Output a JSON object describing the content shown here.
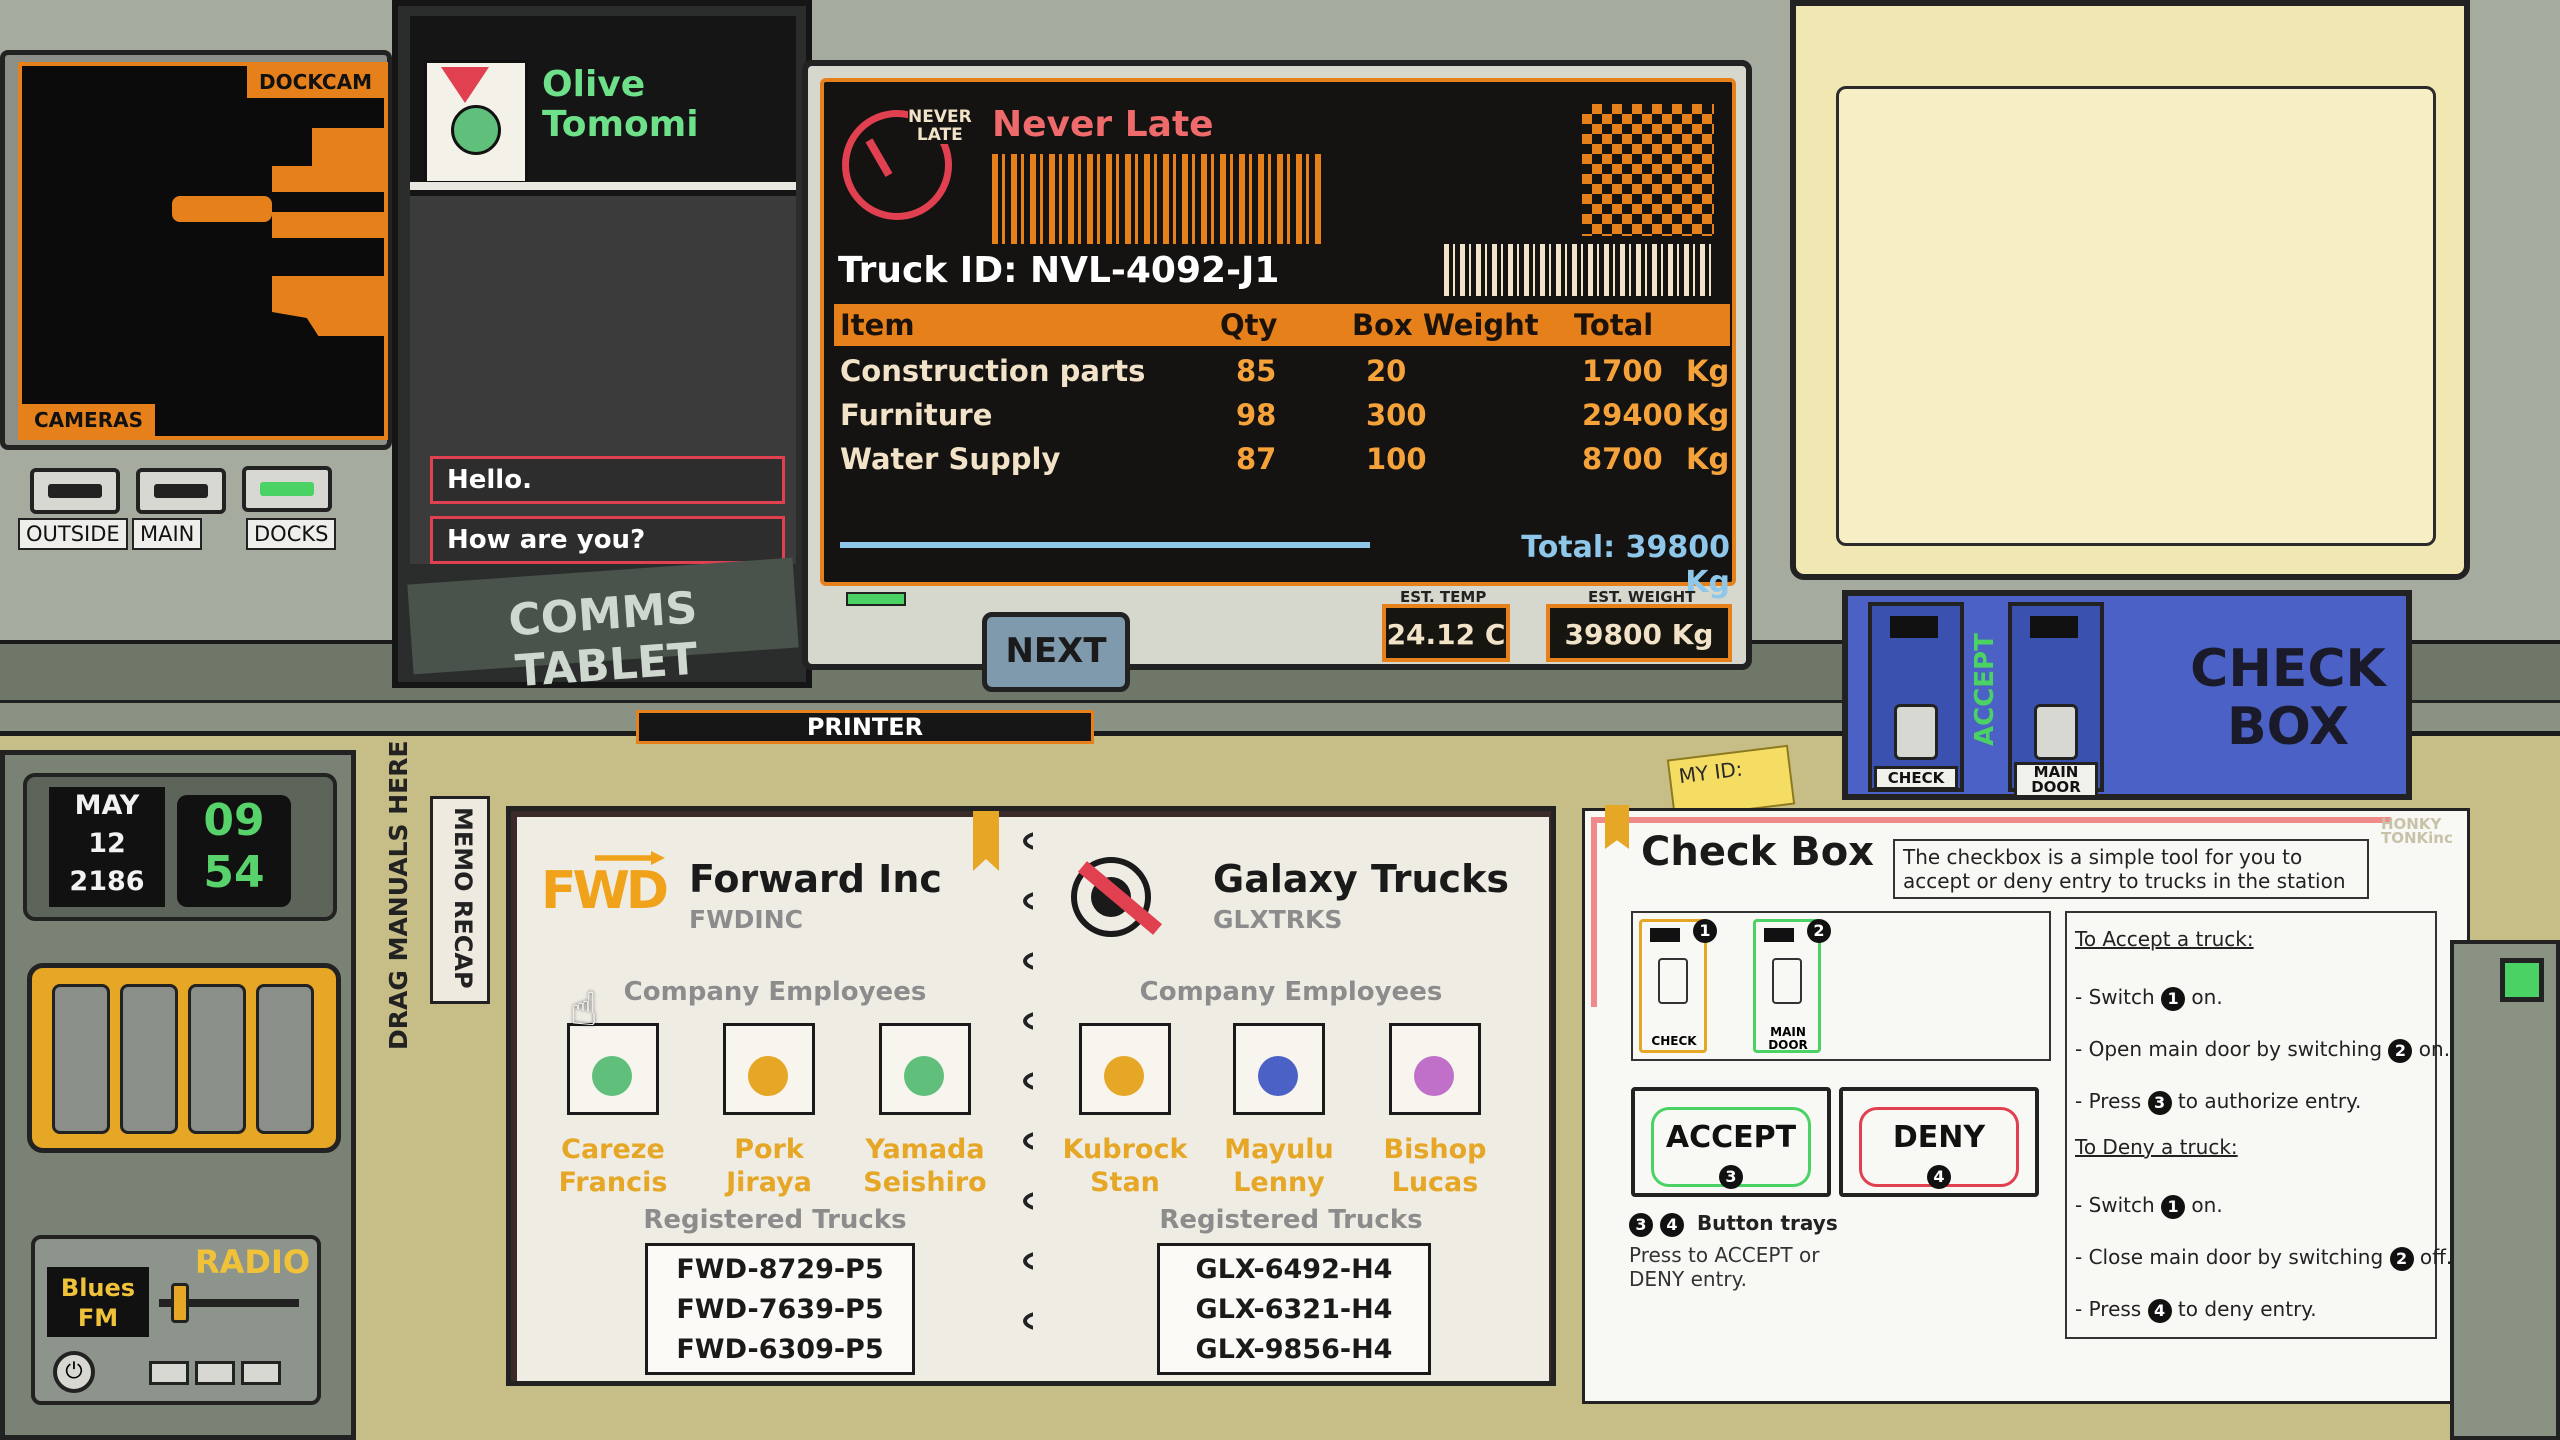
{
  "dockcam": {
    "title": "DOCKCAM",
    "cameras_label": "CAMERAS",
    "buttons": [
      "OUTSIDE",
      "MAIN",
      "DOCKS"
    ]
  },
  "comms": {
    "contact_name_1": "Olive",
    "contact_name_2": "Tomomi",
    "messages": [
      "Hello.",
      "How are you?"
    ],
    "title": "COMMS TABLET"
  },
  "manifest": {
    "company": "Never Late",
    "logo_text_1": "NEVER",
    "logo_text_2": "LATE",
    "truck_id": "Truck ID: NVL-4092-J1",
    "columns": [
      "Item",
      "Qty",
      "Box Weight",
      "Total"
    ],
    "rows": [
      {
        "item": "Construction parts",
        "qty": "85",
        "box_weight": "20",
        "total": "1700",
        "unit": "Kg"
      },
      {
        "item": "Furniture",
        "qty": "98",
        "box_weight": "300",
        "total": "29400",
        "unit": "Kg"
      },
      {
        "item": "Water Supply",
        "qty": "87",
        "box_weight": "100",
        "total": "8700",
        "unit": "Kg"
      }
    ],
    "total": "Total: 39800 Kg"
  },
  "controls": {
    "next_label": "NEXT",
    "est_temp_caption": "EST. TEMP",
    "est_temp_value": "24.12 C",
    "est_weight_caption": "EST. WEIGHT",
    "est_weight_value": "39800 Kg",
    "printer_label": "PRINTER"
  },
  "checkbox_device": {
    "title_line_1": "CHECK",
    "title_line_2": "BOX",
    "switch_1": "CHECK",
    "switch_2_line_1": "MAIN",
    "switch_2_line_2": "DOOR",
    "accept_text": "ACCEPT",
    "sticky_note": "MY ID:"
  },
  "clock": {
    "month": "MAY",
    "day": "12",
    "year": "2186",
    "hour": "09",
    "minute": "54"
  },
  "radio": {
    "title": "RADIO",
    "station_line_1": "Blues",
    "station_line_2": "FM",
    "volume_level": 0.1
  },
  "memo": {
    "tab_label": "MEMO RECAP",
    "drag_label": "DRAG MANUALS HERE",
    "companies": [
      {
        "name": "Forward Inc",
        "code": "FWDINC",
        "logo": "FWD",
        "employees_header": "Company Employees",
        "employees": [
          {
            "first": "Careze",
            "last": "Francis"
          },
          {
            "first": "Pork",
            "last": "Jiraya"
          },
          {
            "first": "Yamada",
            "last": "Seishiro"
          }
        ],
        "trucks_header": "Registered Trucks",
        "trucks": [
          "FWD-8729-P5",
          "FWD-7639-P5",
          "FWD-6309-P5"
        ]
      },
      {
        "name": "Galaxy Trucks",
        "code": "GLXTRKS",
        "employees_header": "Company Employees",
        "employees": [
          {
            "first": "Kubrock",
            "last": "Stan"
          },
          {
            "first": "Mayulu",
            "last": "Lenny"
          },
          {
            "first": "Bishop",
            "last": "Lucas"
          }
        ],
        "trucks_header": "Registered Trucks",
        "trucks": [
          "GLX-6492-H4",
          "GLX-6321-H4",
          "GLX-9856-H4"
        ]
      }
    ]
  },
  "checkbox_manual": {
    "title": "Check Box",
    "brand_1": "HONKY",
    "brand_2": "TONKinc",
    "description": "The checkbox is a simple tool for you to accept or deny entry to trucks in the station",
    "switch_1_label": "CHECK",
    "switch_2_label_1": "MAIN",
    "switch_2_label_2": "DOOR",
    "accept_label": "ACCEPT",
    "deny_label": "DENY",
    "trays_caption": "Button trays",
    "trays_desc_1": "Press to ACCEPT or",
    "trays_desc_2": "DENY entry.",
    "accept_heading": "To Accept a truck:",
    "accept_steps": [
      {
        "pre": "- Switch ",
        "num": "1",
        "post": " on."
      },
      {
        "pre": "- Open main door by switching ",
        "num": "2",
        "post": " on."
      },
      {
        "pre": "- Press ",
        "num": "3",
        "post": " to authorize entry."
      }
    ],
    "deny_heading": "To Deny a truck:",
    "deny_steps": [
      {
        "pre": "- Switch ",
        "num": "1",
        "post": " on."
      },
      {
        "pre": "- Close main door by switching ",
        "num": "2",
        "post": " off."
      },
      {
        "pre": "- Press ",
        "num": "4",
        "post": " to deny entry."
      }
    ],
    "numbers": [
      "1",
      "2",
      "3",
      "4"
    ]
  },
  "colors": {
    "accent_orange": "#e6801b",
    "accent_red": "#e0404f",
    "accept_green": "#4bd264",
    "checkbox_blue": "#4b61c5",
    "employee_name_yellow": "#e6a626"
  }
}
